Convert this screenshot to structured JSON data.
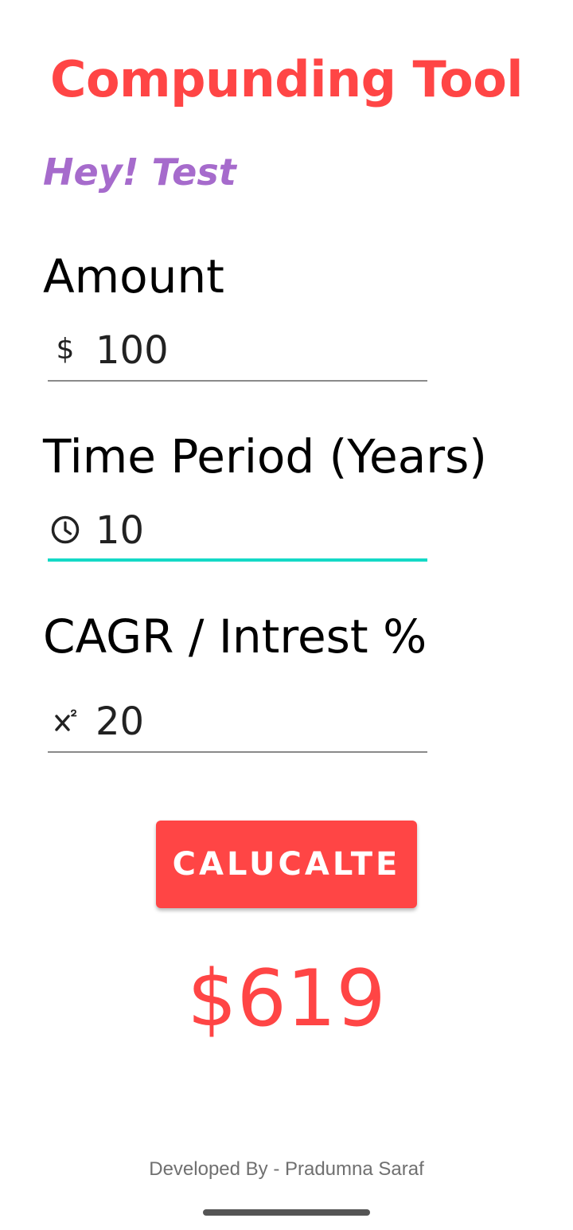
{
  "app": {
    "title": "Compunding Tool",
    "greeting": "Hey! Test"
  },
  "fields": {
    "amount": {
      "label": "Amount",
      "icon": "dollar-icon",
      "icon_text": "$",
      "value": "100"
    },
    "time_period": {
      "label": "Time Period (Years)",
      "icon": "clock-icon",
      "value": "10",
      "focused": true
    },
    "cagr": {
      "label": "CAGR / Intrest %",
      "icon": "superscript-icon",
      "value": "20"
    }
  },
  "calculate_button": {
    "label": "CALUCALTE"
  },
  "result": {
    "value": "$619"
  },
  "footer": {
    "credit": "Developed By - Pradumna Saraf"
  },
  "colors": {
    "accent": "#ff4545",
    "greeting": "#a66bcc",
    "focus_underline": "#14d9c6",
    "underline": "#8a8a8a"
  }
}
